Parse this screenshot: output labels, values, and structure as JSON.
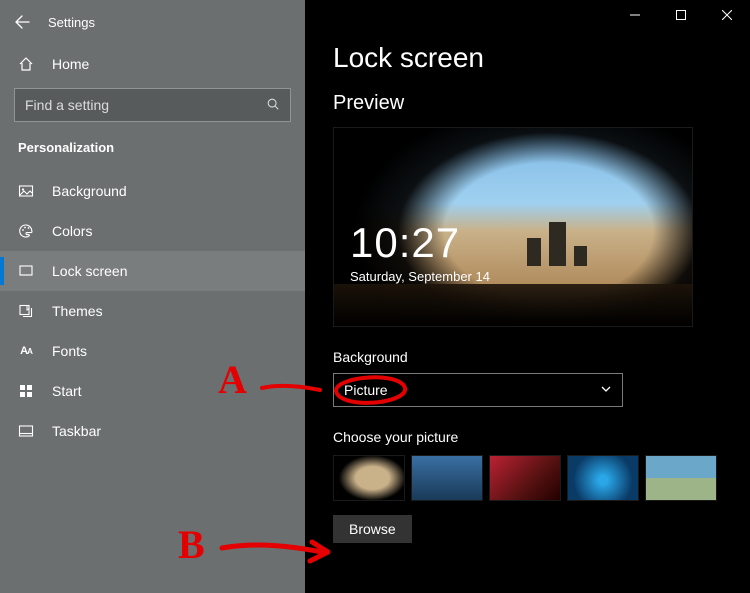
{
  "window": {
    "app_title": "Settings"
  },
  "sidebar": {
    "home_label": "Home",
    "search_placeholder": "Find a setting",
    "category": "Personalization",
    "items": [
      {
        "label": "Background"
      },
      {
        "label": "Colors"
      },
      {
        "label": "Lock screen"
      },
      {
        "label": "Themes"
      },
      {
        "label": "Fonts"
      },
      {
        "label": "Start"
      },
      {
        "label": "Taskbar"
      }
    ],
    "selected_index": 2
  },
  "main": {
    "title": "Lock screen",
    "preview_label": "Preview",
    "clock_time": "10:27",
    "clock_date": "Saturday, September 14",
    "background_label": "Background",
    "background_dropdown_value": "Picture",
    "choose_picture_label": "Choose your picture",
    "browse_label": "Browse"
  },
  "annotations": {
    "a": "A",
    "b": "B"
  }
}
